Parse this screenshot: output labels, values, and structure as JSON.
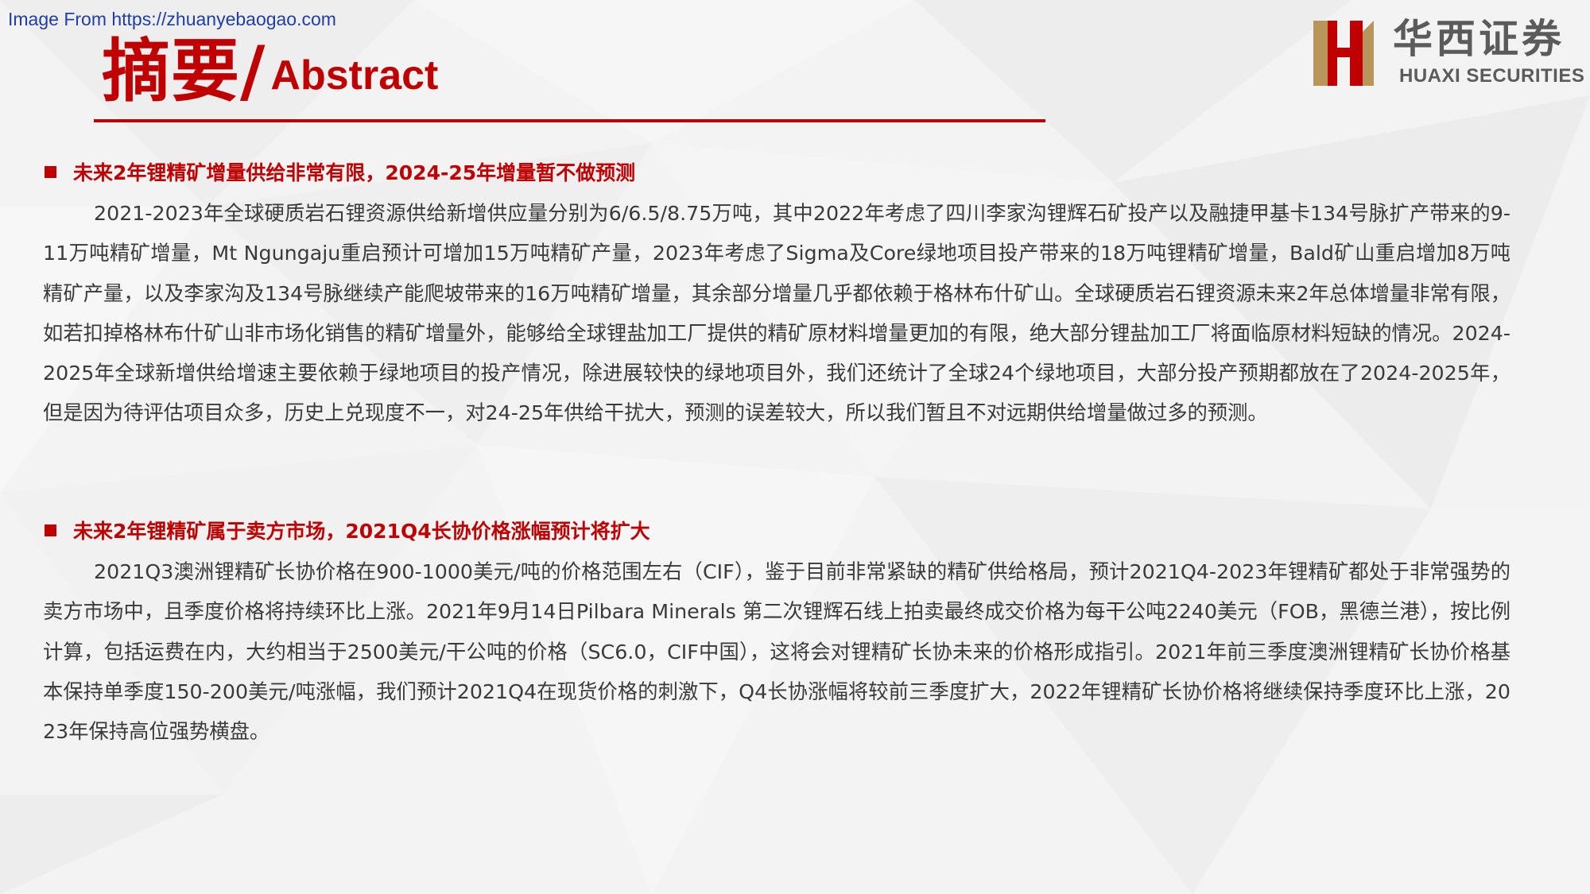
{
  "source_note": "Image From https://zhuanyebaogao.com",
  "title": {
    "chinese": "摘要/",
    "english": "Abstract"
  },
  "logo": {
    "chinese": "华西证券",
    "english": "HUAXI SECURITIES"
  },
  "sections": [
    {
      "heading": "未来2年锂精矿增量供给非常有限，2024-25年增量暂不做预测",
      "paragraph": "2021-2023年全球硬质岩石锂资源供给新增供应量分别为6/6.5/8.75万吨，其中2022年考虑了四川李家沟锂辉石矿投产以及融捷甲基卡134号脉扩产带来的9-11万吨精矿增量，Mt Ngungaju重启预计可增加15万吨精矿产量，2023年考虑了Sigma及Core绿地项目投产带来的18万吨锂精矿增量，Bald矿山重启增加8万吨精矿产量，以及李家沟及134号脉继续产能爬坡带来的16万吨精矿增量，其余部分增量几乎都依赖于格林布什矿山。全球硬质岩石锂资源未来2年总体增量非常有限，如若扣掉格林布什矿山非市场化销售的精矿增量外，能够给全球锂盐加工厂提供的精矿原材料增量更加的有限，绝大部分锂盐加工厂将面临原材料短缺的情况。2024-2025年全球新增供给增速主要依赖于绿地项目的投产情况，除进展较快的绿地项目外，我们还统计了全球24个绿地项目，大部分投产预期都放在了2024-2025年，但是因为待评估项目众多，历史上兑现度不一，对24-25年供给干扰大，预测的误差较大，所以我们暂且不对远期供给增量做过多的预测。"
    },
    {
      "heading": "未来2年锂精矿属于卖方市场，2021Q4长协价格涨幅预计将扩大",
      "paragraph": "2021Q3澳洲锂精矿长协价格在900-1000美元/吨的价格范围左右（CIF），鉴于目前非常紧缺的精矿供给格局，预计2021Q4-2023年锂精矿都处于非常强势的卖方市场中，且季度价格将持续环比上涨。2021年9月14日Pilbara Minerals 第二次锂辉石线上拍卖最终成交价格为每干公吨2240美元（FOB，黑德兰港），按比例计算，包括运费在内，大约相当于2500美元/干公吨的价格（SC6.0，CIF中国），这将会对锂精矿长协未来的价格形成指引。2021年前三季度澳洲锂精矿长协价格基本保持单季度150-200美元/吨涨幅，我们预计2021Q4在现货价格的刺激下，Q4长协涨幅将较前三季度扩大，2022年锂精矿长协价格将继续保持季度环比上涨，2023年保持高位强势横盘。"
    }
  ],
  "colors": {
    "accent_red": "#c00000",
    "body_text": "#3a3a3a",
    "source_link_blue": "#1f3fa6",
    "logo_gray": "#5b5b5b",
    "logo_gold": "#b8955a"
  }
}
